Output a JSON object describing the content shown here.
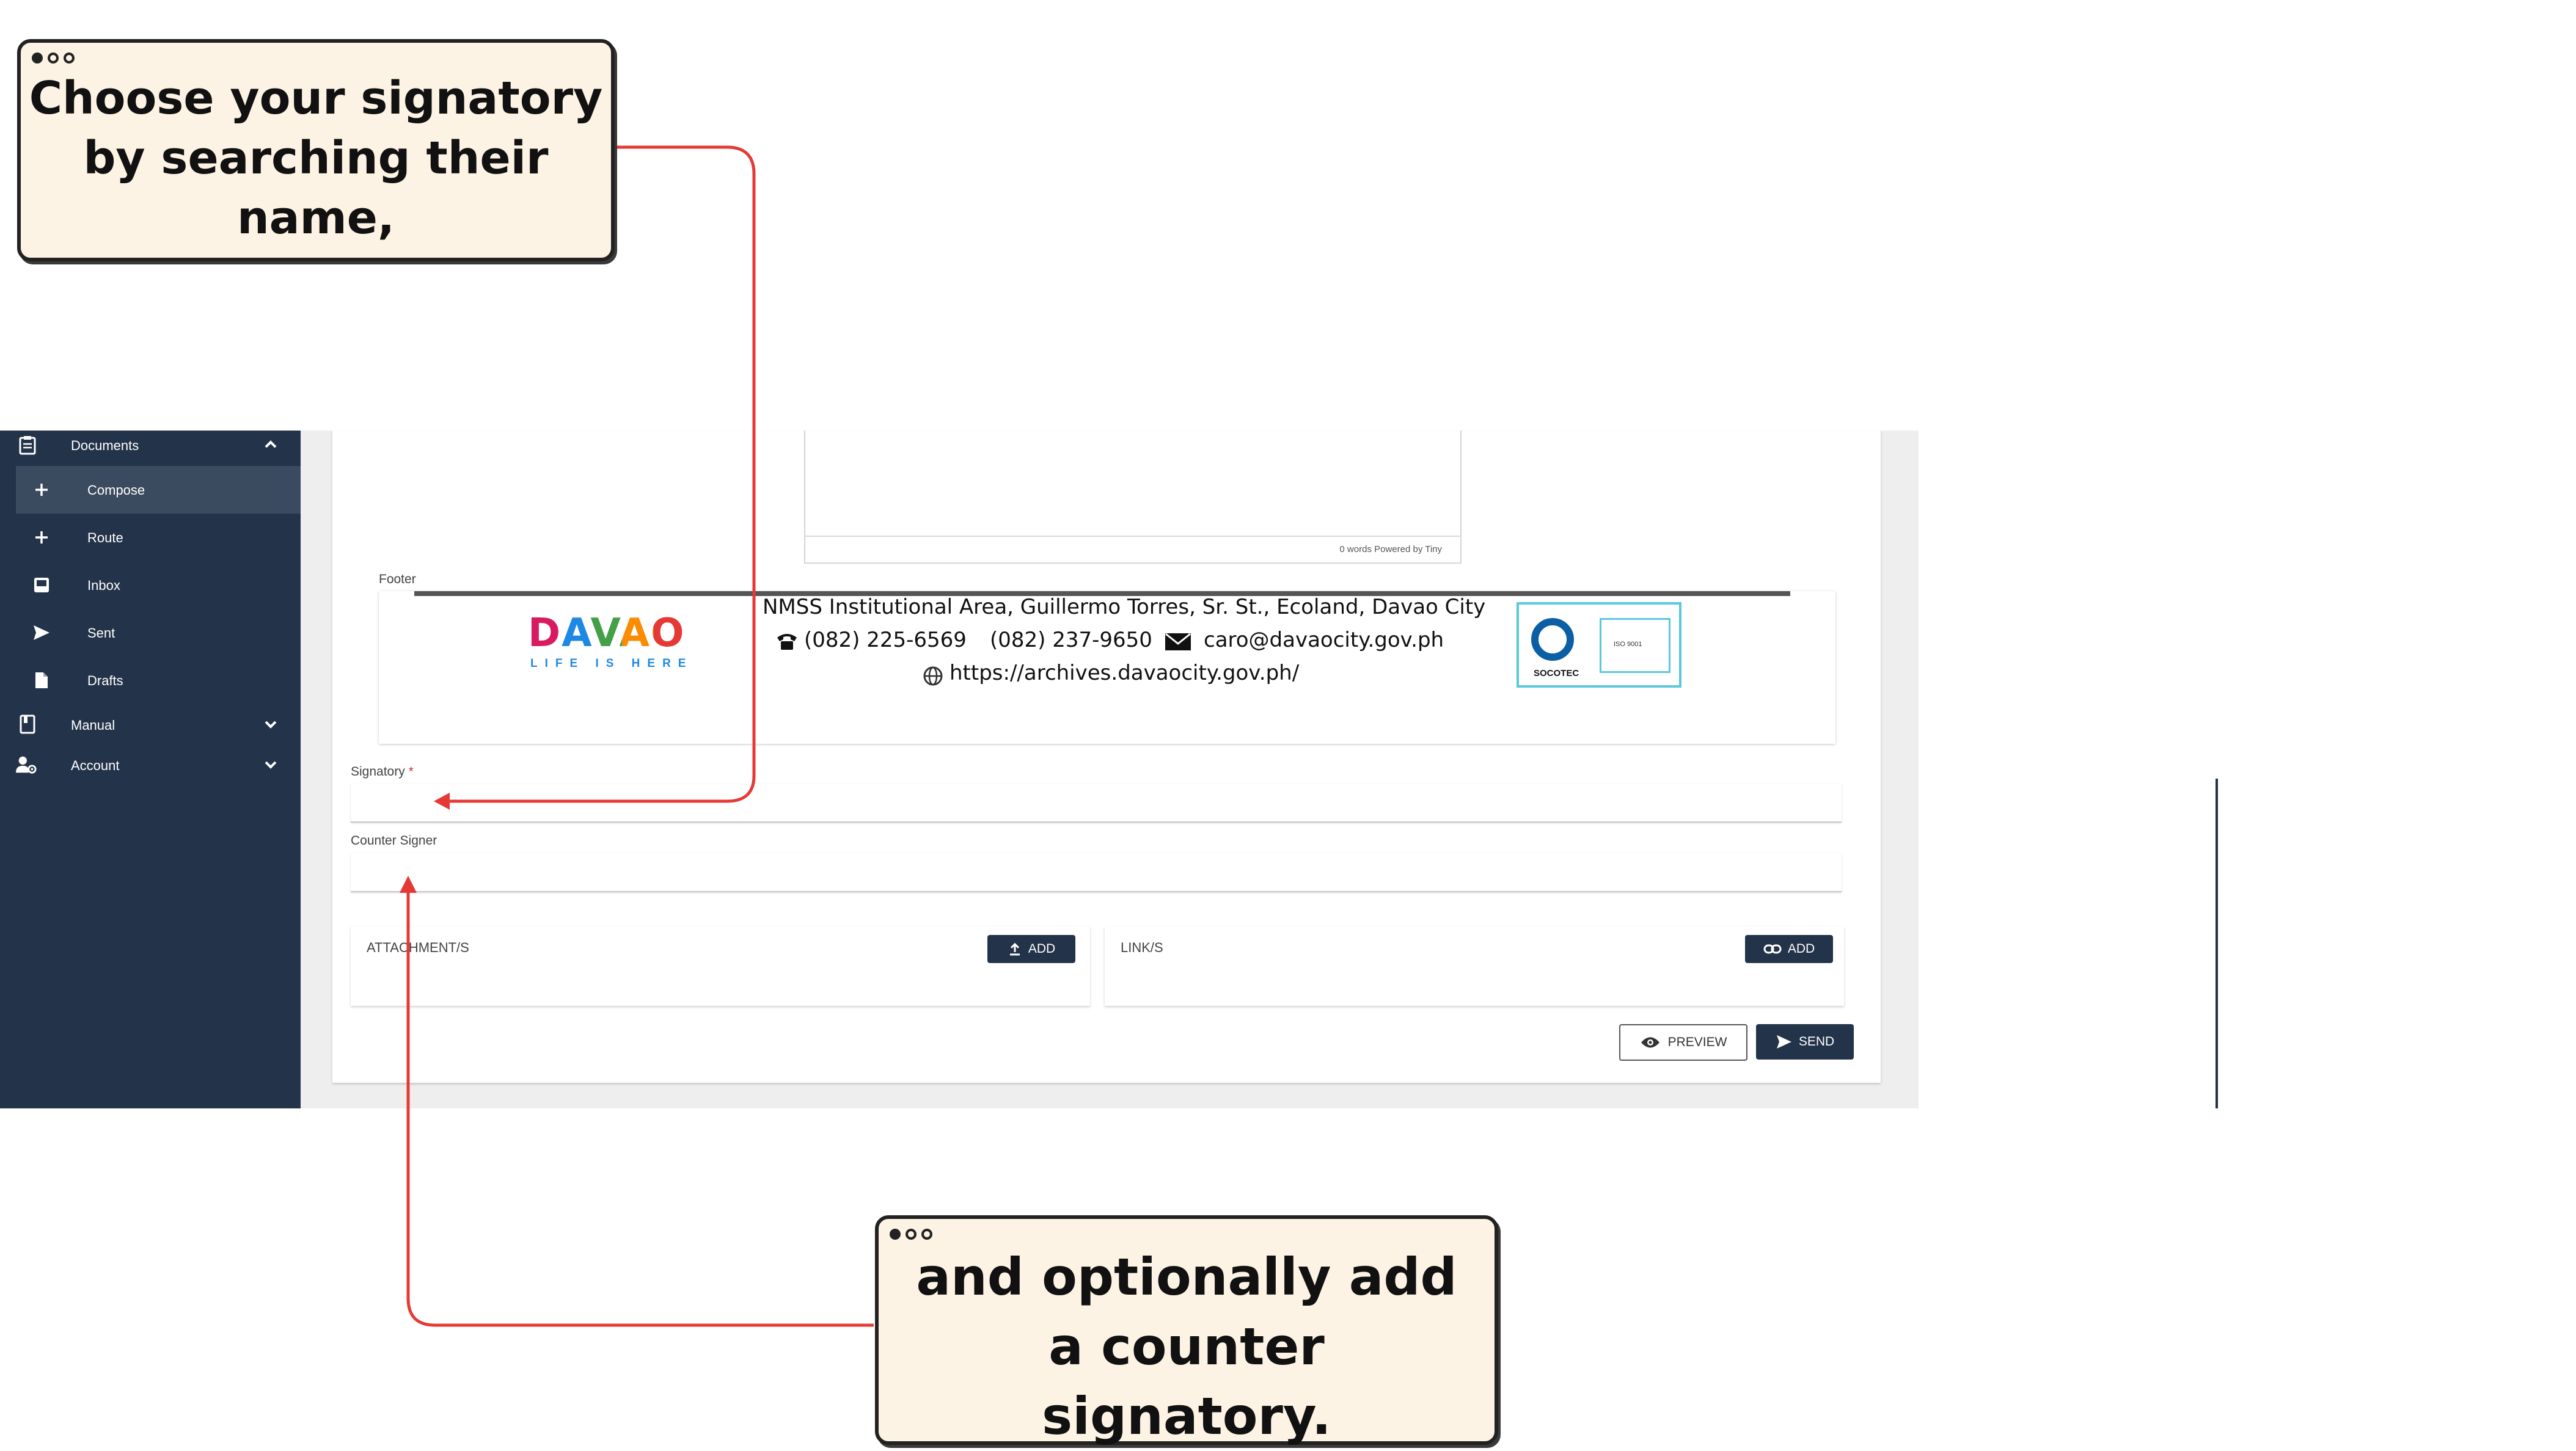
{
  "sidebar": {
    "items": [
      {
        "label": "Documents",
        "icon": "clipboard-icon",
        "expanded": true
      },
      {
        "label": "Compose",
        "icon": "plus-icon",
        "active": true
      },
      {
        "label": "Route",
        "icon": "plus-icon"
      },
      {
        "label": "Inbox",
        "icon": "inbox-icon"
      },
      {
        "label": "Sent",
        "icon": "send-icon"
      },
      {
        "label": "Drafts",
        "icon": "file-icon"
      },
      {
        "label": "Manual",
        "icon": "book-icon",
        "expanded": false
      },
      {
        "label": "Account",
        "icon": "user-gear-icon",
        "expanded": false
      }
    ]
  },
  "editor": {
    "status": "0 words Powered by Tiny"
  },
  "footer": {
    "label": "Footer",
    "logo_text": "DAVAO",
    "logo_tagline": "LIFE IS HERE",
    "address": "NMSS Institutional Area, Guillermo Torres, Sr. St., Ecoland, Davao City",
    "phone1": "(082) 225-6569",
    "phone2": "(082) 237-9650",
    "email": "caro@davaocity.gov.ph",
    "website": "https://archives.davaocity.gov.ph/",
    "cert_label": "SOCOTEC",
    "cert_iso": "ISO 9001"
  },
  "form": {
    "signatory_label": "Signatory",
    "required_mark": "*",
    "counter_signer_label": "Counter Signer",
    "attachments_label": "ATTACHMENT/S",
    "links_label": "LINK/S",
    "add_label": "ADD",
    "preview_label": "PREVIEW",
    "send_label": "SEND"
  },
  "callouts": {
    "top": [
      "Choose your signatory",
      "by searching their",
      "name,"
    ],
    "bottom": [
      "and optionally add",
      "a counter",
      "signatory."
    ]
  },
  "colors": {
    "sidebar": "#233349",
    "active_item": "#3a4a5f",
    "callout_bg": "#fdf3e4",
    "arrow": "#e53935",
    "required": "#d32f2f"
  }
}
